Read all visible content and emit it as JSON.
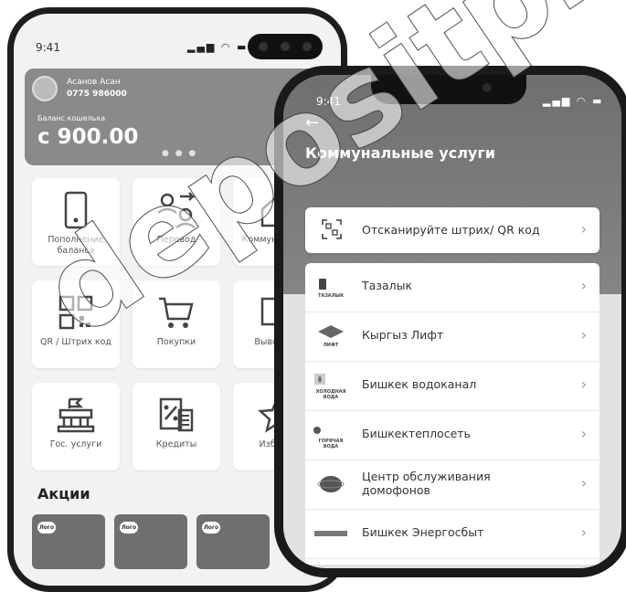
{
  "back_phone": {
    "status_time": "9:41",
    "user_name": "Асанов Асан",
    "user_phone": "0775 986000",
    "wallet_label": "Баланс кошелька",
    "balance": "c 900.00",
    "tiles": [
      {
        "label": "Пополнение баланса",
        "icon": "phone-icon"
      },
      {
        "label": "Перевод",
        "icon": "transfer-icon"
      },
      {
        "label": "Коммун... усл...",
        "icon": "house-icon"
      },
      {
        "label": "QR / Штрих код",
        "icon": "qr-icon"
      },
      {
        "label": "Покупки",
        "icon": "cart-icon"
      },
      {
        "label": "Вывод с...",
        "icon": "withdraw-icon"
      },
      {
        "label": "Гос. услуги",
        "icon": "government-icon"
      },
      {
        "label": "Кредиты",
        "icon": "credit-icon"
      },
      {
        "label": "Избра...",
        "icon": "star-icon"
      }
    ],
    "promotions_title": "Акции",
    "promo_logo": "Лого"
  },
  "front_phone": {
    "status_time": "9:41",
    "title": "Коммунальные услуги",
    "scan_label": "Отсканируйте штрих/ QR код",
    "providers": [
      {
        "name": "Тазалык",
        "logo_text": "ТАЗАЛЫК"
      },
      {
        "name": "Кыргыз Лифт",
        "logo_text": "ЛИФТ"
      },
      {
        "name": "Бишкек водоканал",
        "logo_text": "ХОЛОДНАЯ ВОДА"
      },
      {
        "name": "Бишкектеплосеть",
        "logo_text": "ГОРЯЧАЯ ВОДА"
      },
      {
        "name": "Центр обслуживания домофонов",
        "logo_text": ""
      },
      {
        "name": "Бишкек Энергосбыт",
        "logo_text": ""
      }
    ]
  },
  "watermark": "depositphotos",
  "colors": {
    "card": "#8a8a8a",
    "header": "#7a7a7a",
    "tile": "#ffffff",
    "background": "#f2f2f2"
  }
}
